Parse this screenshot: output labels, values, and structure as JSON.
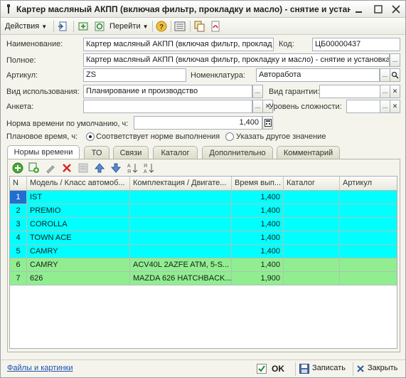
{
  "window": {
    "title": "Картер масляный АКПП (включая фильтр, прокладку и масло) - снятие и устан...",
    "controls": [
      "minimize",
      "maximize",
      "close"
    ]
  },
  "toolbar": {
    "actions_label": "Действия",
    "goto_label": "Перейти",
    "icons": [
      "new-doc-icon",
      "save-copy-icon",
      "refresh-icon",
      "tree-icon",
      "help-icon",
      "list-icon",
      "copy-icon",
      "pdf-icon"
    ]
  },
  "form": {
    "name_label": "Наименование:",
    "name_value": "Картер масляный АКПП (включая фильтр, проклад",
    "code_label": "Код:",
    "code_value": "ЦБ00000437",
    "full_label": "Полное:",
    "full_value": "Картер масляный АКПП (включая фильтр, прокладку и масло) - снятие и установка",
    "article_label": "Артикул:",
    "article_value": "ZS",
    "nomenclature_label": "Номенклатура:",
    "nomenclature_value": "Авторабота",
    "usage_label": "Вид использования:",
    "usage_value": "Планирование и производство",
    "warranty_label": "Вид гарантии:",
    "warranty_value": "",
    "survey_label": "Анкета:",
    "survey_value": "",
    "complexity_label": "Уровень сложности:",
    "complexity_value": "",
    "norm_label": "Норма времени по умолчанию, ч:",
    "norm_value": "1,400",
    "planned_label": "Плановое время, ч:",
    "radio_norm_label": "Соответствует норме выполнения",
    "radio_other_label": "Указать другое значение",
    "radio_selected": "norm"
  },
  "tabs": [
    {
      "label": "Нормы времени",
      "active": true
    },
    {
      "label": "ТО",
      "active": false
    },
    {
      "label": "Связи",
      "active": false
    },
    {
      "label": "Каталог",
      "active": false
    },
    {
      "label": "Дополнительно",
      "active": false
    },
    {
      "label": "Комментарий",
      "active": false
    }
  ],
  "grid_toolbar_icons": [
    "add-icon",
    "copy-row-icon",
    "edit-icon",
    "delete-icon",
    "disabled-icon",
    "move-up-icon",
    "move-down-icon",
    "sort-asc-icon",
    "sort-desc-icon"
  ],
  "grid": {
    "columns": [
      "N",
      "Модель / Класс автомоб...",
      "Комплектация / Двигате...",
      "Время вып...",
      "Каталог",
      "Артикул"
    ],
    "rows": [
      {
        "n": "1",
        "model": "IST",
        "config": "",
        "time": "1,400",
        "catalog": "",
        "article": "",
        "color": "#00ffff"
      },
      {
        "n": "2",
        "model": "PREMIO",
        "config": "",
        "time": "1,400",
        "catalog": "",
        "article": "",
        "color": "#00ffff"
      },
      {
        "n": "3",
        "model": "COROLLA",
        "config": "",
        "time": "1,400",
        "catalog": "",
        "article": "",
        "color": "#00ffff"
      },
      {
        "n": "4",
        "model": "TOWN ACE",
        "config": "",
        "time": "1,400",
        "catalog": "",
        "article": "",
        "color": "#00ffff"
      },
      {
        "n": "5",
        "model": "CAMRY",
        "config": "",
        "time": "1,400",
        "catalog": "",
        "article": "",
        "color": "#00ffff"
      },
      {
        "n": "6",
        "model": "CAMRY",
        "config": "ACV40L 2AZFE ATM, 5-S...",
        "time": "1,400",
        "catalog": "",
        "article": "",
        "color": "#90ee90"
      },
      {
        "n": "7",
        "model": "626",
        "config": "MAZDA 626 HATCHBACK...",
        "time": "1,900",
        "catalog": "",
        "article": "",
        "color": "#90ee90"
      }
    ]
  },
  "footer": {
    "files_link": "Файлы и картинки",
    "ok_label": "OK",
    "save_label": "Записать",
    "close_label": "Закрыть"
  },
  "colors": {
    "row_cyan": "#00ffff",
    "row_green": "#90ee90",
    "link": "#1f4fb0"
  }
}
